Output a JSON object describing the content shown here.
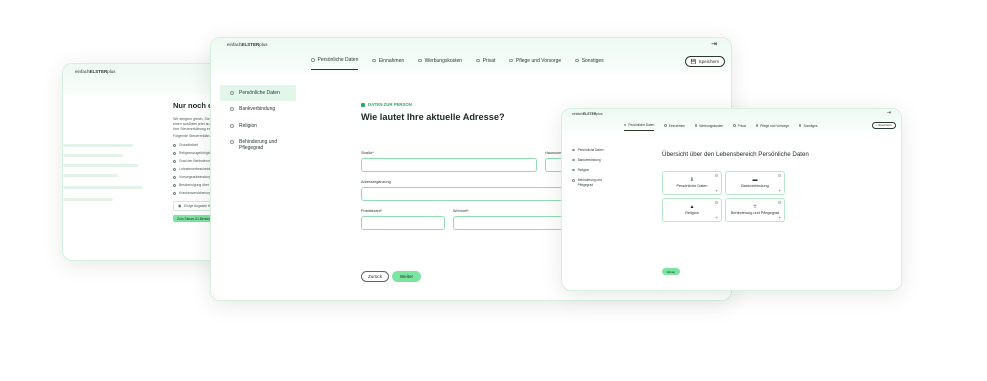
{
  "brand": {
    "prefix": "einfach",
    "name": "ELSTER",
    "suffix": "plus"
  },
  "colors": {
    "accent": "#7be4a0",
    "accent_dark": "#2fa866",
    "border": "#8fdcb0"
  },
  "back_window": {
    "title": "Nur noch ein",
    "intro_lines": [
      "Wir steigern gleich, Sie",
      "einen ausDatei jetzt au",
      "Ihre Steuererklärung er"
    ],
    "list_heading": "Folgende Steuererklärung g",
    "list": [
      "Grundfreibet",
      "Religionszugehörigke",
      "Grad der Behinderun",
      "Lohnsteuerbescheini",
      "Vorsorgeaufwendunge",
      "Bescheinigung über",
      "Krankenversicherungs"
    ],
    "info_text": "Einige Angaben fehlen",
    "action": "Zum Steuer-ID-Bereich"
  },
  "main_window": {
    "logout_icon": "logout-icon",
    "tabs": [
      "Persönliche Daten",
      "Einnahmen",
      "Werbungskosten",
      "Privat",
      "Pflege und Vorsorge",
      "Sonstiges"
    ],
    "save": "Speichern",
    "sidebar": [
      "Persönliche Daten",
      "Bankverbindung",
      "Religion",
      "Behinderung und Pflegegrad"
    ],
    "section": "DATEN ZUR PERSON",
    "heading": "Wie lautet Ihre aktuelle Adresse?",
    "fields": {
      "street": "Straße*",
      "house_number": "Hausnum",
      "address_extra": "Adressergänzung",
      "zip": "Postleitzahl*",
      "city": "Wohnort*"
    },
    "back": "Zurück",
    "next": "Weiter"
  },
  "right_window": {
    "tabs": [
      "Persönliche Daten",
      "Einnahmen",
      "Werbungskosten",
      "Privat",
      "Pflege und Vorsorge",
      "Sonstiges"
    ],
    "save": "Speichern",
    "sidebar": [
      "Persönliche Daten",
      "Bankverbindung",
      "Religion",
      "Behinderung und Pflegegrad"
    ],
    "heading": "Übersicht über den Lebensbereich Persönliche Daten",
    "cards": [
      {
        "label": "Persönliche Daten",
        "icon": "info-icon"
      },
      {
        "label": "Bankverbindung",
        "icon": "bank-card-icon"
      },
      {
        "label": "Religion",
        "icon": "church-icon"
      },
      {
        "label": "Behinderung und Pflegegrad",
        "icon": "accessibility-icon"
      }
    ],
    "next": "Weiter"
  }
}
